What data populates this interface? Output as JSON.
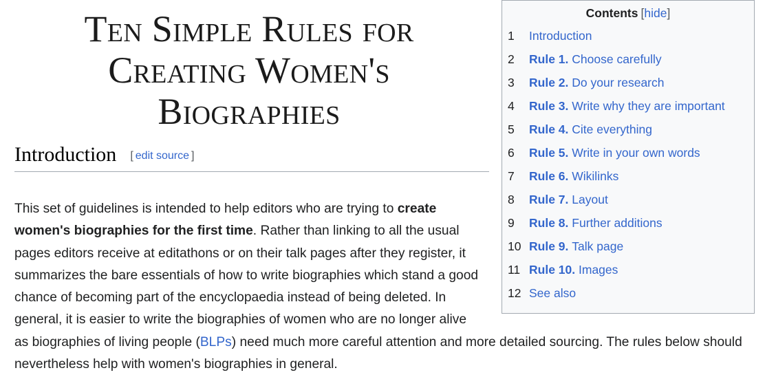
{
  "page": {
    "title": "Ten Simple Rules for Creating Women's Biographies",
    "accent_link_color": "#3366cc",
    "text_color": "#202122",
    "toc_background": "#f8f9fa",
    "toc_border_color": "#a2a9b1"
  },
  "toc": {
    "heading": "Contents",
    "toggle_open_bracket": "[",
    "toggle_label": "hide",
    "toggle_close_bracket": "]",
    "items": [
      {
        "number": "1",
        "rule": "",
        "label": "Introduction"
      },
      {
        "number": "2",
        "rule": "Rule 1.",
        "label": "Choose carefully"
      },
      {
        "number": "3",
        "rule": "Rule 2.",
        "label": "Do your research"
      },
      {
        "number": "4",
        "rule": "Rule 3.",
        "label": "Write why they are important"
      },
      {
        "number": "5",
        "rule": "Rule 4.",
        "label": "Cite everything"
      },
      {
        "number": "6",
        "rule": "Rule 5.",
        "label": "Write in your own words"
      },
      {
        "number": "7",
        "rule": "Rule 6.",
        "label": "Wikilinks"
      },
      {
        "number": "8",
        "rule": "Rule 7.",
        "label": "Layout"
      },
      {
        "number": "9",
        "rule": "Rule 8.",
        "label": "Further additions"
      },
      {
        "number": "10",
        "rule": "Rule 9.",
        "label": "Talk page"
      },
      {
        "number": "11",
        "rule": "Rule 10.",
        "label": "Images"
      },
      {
        "number": "12",
        "rule": "",
        "label": "See also"
      }
    ]
  },
  "section": {
    "heading": "Introduction",
    "edit_open_bracket": "[",
    "edit_link_label": "edit source",
    "edit_close_bracket": "]"
  },
  "paragraph": {
    "part1": "This set of guidelines is intended to help editors who are trying to ",
    "bold1": "create women's biographies for the first time",
    "part2": ". Rather than linking to all the usual pages editors receive at editathons or on their talk pages after they register, it summarizes the bare essentials of how to write biographies which stand a good chance of becoming part of the encyclopaedia instead of being deleted. In general, it is easier to write the biographies of women who are no longer alive as biographies of living people (",
    "link1": "BLPs",
    "part3": ") need much more careful attention and more detailed sourcing. The rules below should nevertheless help with women's biographies in general."
  }
}
